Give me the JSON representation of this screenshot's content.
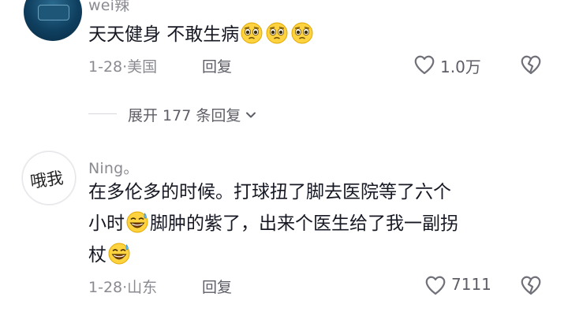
{
  "comments": [
    {
      "username": "wei辣",
      "text": "天天健身 不敢生病",
      "emojis": [
        "pleading-face",
        "pleading-face",
        "pleading-face"
      ],
      "date": "1-28",
      "location": "美国",
      "reply_label": "回复",
      "likes": "1.0万",
      "expand_label": "展开 177 条回复"
    },
    {
      "username": "Ning。",
      "avatar_text": "哦我",
      "text_line1": "在多伦多的时候。打球扭了脚去医院等了六个",
      "text_line2a": "小时",
      "text_line2b": "脚肿的紫了，出来个医生给了我一副拐",
      "text_line3": "杖",
      "emojis": [
        "grinning-sweat",
        "grinning-sweat"
      ],
      "date": "1-28",
      "location": "山东",
      "reply_label": "回复",
      "likes": "7111"
    }
  ],
  "colors": {
    "text": "#161823",
    "meta": "#8a8b91",
    "emoji_face": "#ffd23f"
  }
}
